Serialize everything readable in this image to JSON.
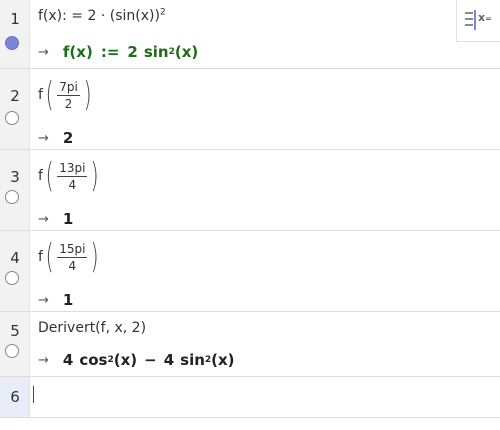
{
  "rows": [
    {
      "number": "1",
      "input": {
        "text": "f(x): = 2 · (sin(x))",
        "exp": "2"
      },
      "output": {
        "arrow": "→",
        "lhs": "f(x)",
        "assign": ":=",
        "coef": "2",
        "func": "sin",
        "exp": "2",
        "arg": "(x)"
      }
    },
    {
      "number": "2",
      "input": {
        "fname": "f",
        "num": "7pi",
        "den": "2"
      },
      "output": {
        "arrow": "→",
        "value": "2"
      }
    },
    {
      "number": "3",
      "input": {
        "fname": "f",
        "num": "13pi",
        "den": "4"
      },
      "output": {
        "arrow": "→",
        "value": "1"
      }
    },
    {
      "number": "4",
      "input": {
        "fname": "f",
        "num": "15pi",
        "den": "4"
      },
      "output": {
        "arrow": "→",
        "value": "1"
      }
    },
    {
      "number": "5",
      "input": {
        "text": "Derivert(f, x, 2)"
      },
      "output": {
        "arrow": "→",
        "t1coef": "4",
        "t1func": "cos",
        "t1exp": "2",
        "t1arg": "(x)",
        "op": "−",
        "t2coef": "4",
        "t2func": "sin",
        "t2exp": "2",
        "t2arg": "(x)"
      }
    },
    {
      "number": "6"
    }
  ],
  "toggle": {
    "label": "x",
    "sub": "="
  }
}
